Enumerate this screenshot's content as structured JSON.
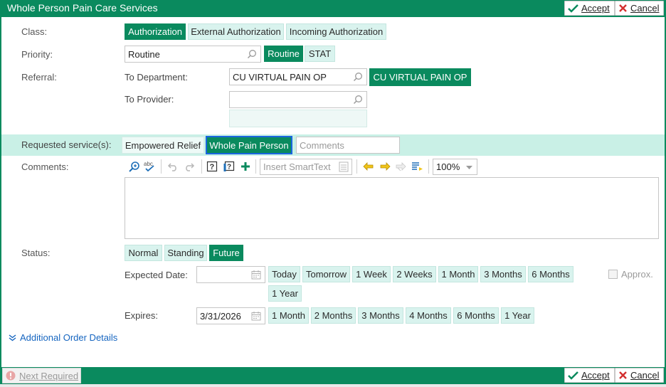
{
  "window": {
    "title": "Whole Person Pain Care Services",
    "accept_label": "Accept",
    "cancel_label": "Cancel"
  },
  "class": {
    "label": "Class:",
    "options": [
      "Authorization",
      "External Authorization",
      "Incoming Authorization"
    ],
    "selected": "Authorization"
  },
  "priority": {
    "label": "Priority:",
    "value": "Routine",
    "options": [
      "Routine",
      "STAT"
    ],
    "selected": "Routine"
  },
  "referral": {
    "label": "Referral:",
    "to_department_label": "To Department:",
    "to_department_value": "CU VIRTUAL PAIN OP",
    "department_chip": "CU VIRTUAL PAIN OP",
    "to_provider_label": "To Provider:",
    "to_provider_value": ""
  },
  "requested_services": {
    "label": "Requested service(s):",
    "options": [
      "Empowered Relief",
      "Whole Pain Person"
    ],
    "selected": "Whole Pain Person",
    "comments_placeholder": "Comments"
  },
  "comments": {
    "label": "Comments:",
    "insert_smarttext_placeholder": "Insert SmartText",
    "zoom": "100%",
    "text": ""
  },
  "status": {
    "label": "Status:",
    "options": [
      "Normal",
      "Standing",
      "Future"
    ],
    "selected": "Future"
  },
  "expected_date": {
    "label": "Expected Date:",
    "value": "",
    "options": [
      "Today",
      "Tomorrow",
      "1 Week",
      "2 Weeks",
      "1 Month",
      "3 Months",
      "6 Months",
      "1 Year"
    ],
    "approx_label": "Approx."
  },
  "expires": {
    "label": "Expires:",
    "value": "3/31/2026",
    "options": [
      "1 Month",
      "2 Months",
      "3 Months",
      "4 Months",
      "6 Months",
      "1 Year"
    ]
  },
  "additional_details_label": "Additional Order Details",
  "footer": {
    "next_required_label": "Next Required",
    "accept_label": "Accept",
    "cancel_label": "Cancel"
  },
  "colors": {
    "brand_green": "#0a8a5e",
    "chip_bg": "#d9f3ee",
    "band_bg": "#c9f0e6",
    "link_blue": "#1565c0",
    "cancel_red": "#d32f2f"
  }
}
